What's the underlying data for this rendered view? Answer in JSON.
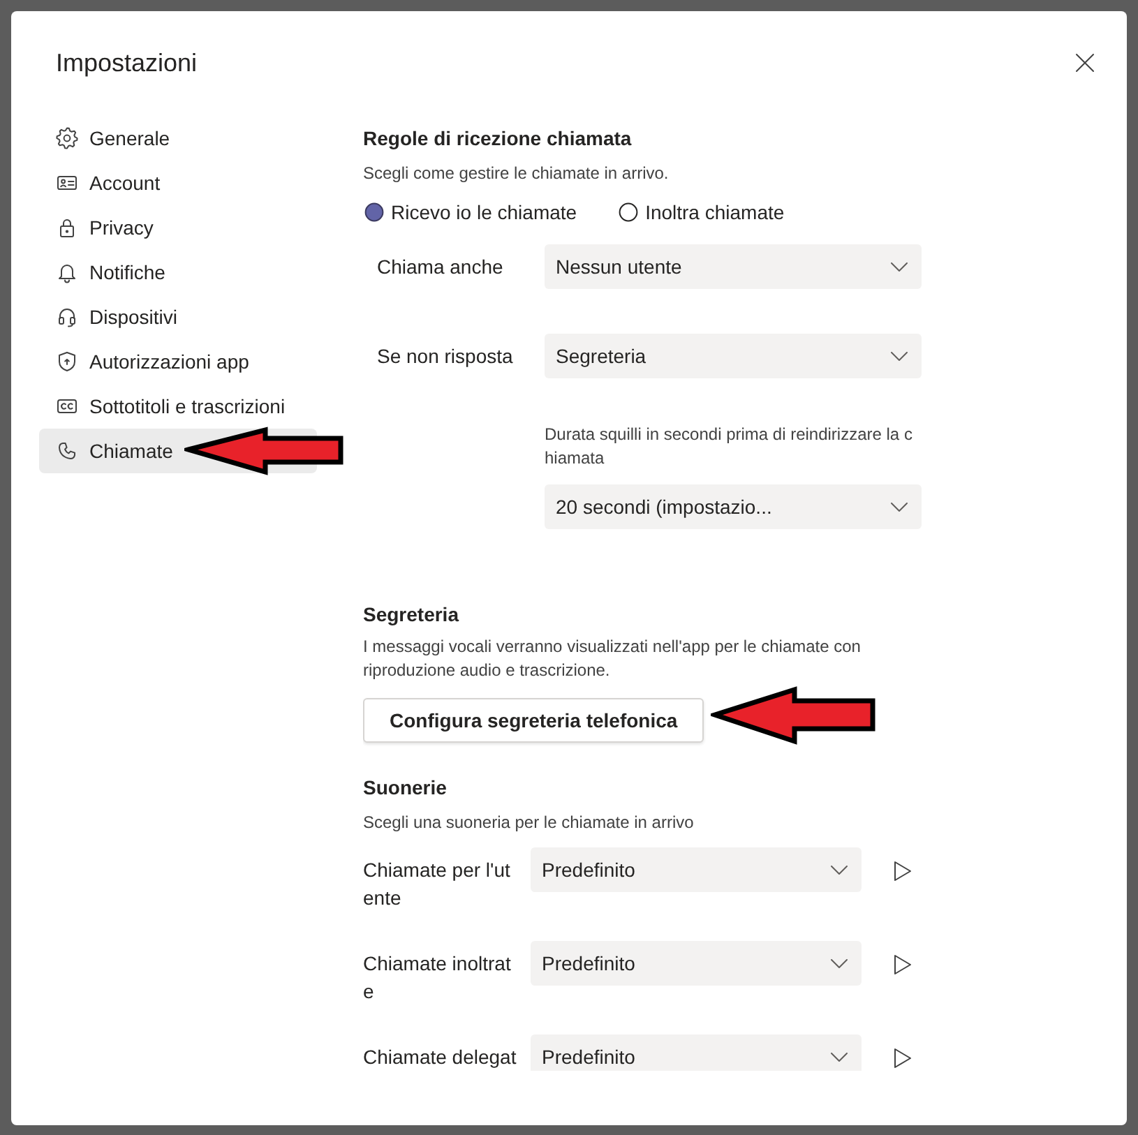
{
  "dialog": {
    "title": "Impostazioni"
  },
  "sidebar": {
    "items": [
      {
        "label": "Generale",
        "selected": false
      },
      {
        "label": "Account",
        "selected": false
      },
      {
        "label": "Privacy",
        "selected": false
      },
      {
        "label": "Notifiche",
        "selected": false
      },
      {
        "label": "Dispositivi",
        "selected": false
      },
      {
        "label": "Autorizzazioni app",
        "selected": false
      },
      {
        "label": "Sottotitoli e trascrizioni",
        "selected": false
      },
      {
        "label": "Chiamate",
        "selected": true
      }
    ]
  },
  "call_rules": {
    "heading": "Regole di ricezione chiamata",
    "description": "Scegli come gestire le chiamate in arrivo.",
    "options": [
      {
        "label": "Ricevo io le chiamate",
        "selected": true
      },
      {
        "label": "Inoltra chiamate",
        "selected": false
      }
    ],
    "fields": [
      {
        "kind": "labeled",
        "label": "Chiama anche",
        "value": "Nessun utente"
      },
      {
        "kind": "labeled",
        "label": "Se non risposta",
        "value": "Segreteria"
      },
      {
        "kind": "note",
        "note": "Durata squilli in secondi prima di reindirizzare la chiamata",
        "value": "20 secondi (impostazio..."
      }
    ]
  },
  "voicemail": {
    "heading": "Segreteria",
    "description": "I messaggi vocali verranno visualizzati nell'app per le chiamate con riproduzione audio e trascrizione.",
    "button": "Configura segreteria telefonica"
  },
  "ringtones": {
    "heading": "Suonerie",
    "description": "Scegli una suoneria per le chiamate in arrivo",
    "rows": [
      {
        "label": "Chiamate per l'utente",
        "value": "Predefinito"
      },
      {
        "label": "Chiamate inoltrate",
        "value": "Predefinito"
      },
      {
        "label": "Chiamate delegat",
        "value": "Predefinito"
      }
    ]
  }
}
